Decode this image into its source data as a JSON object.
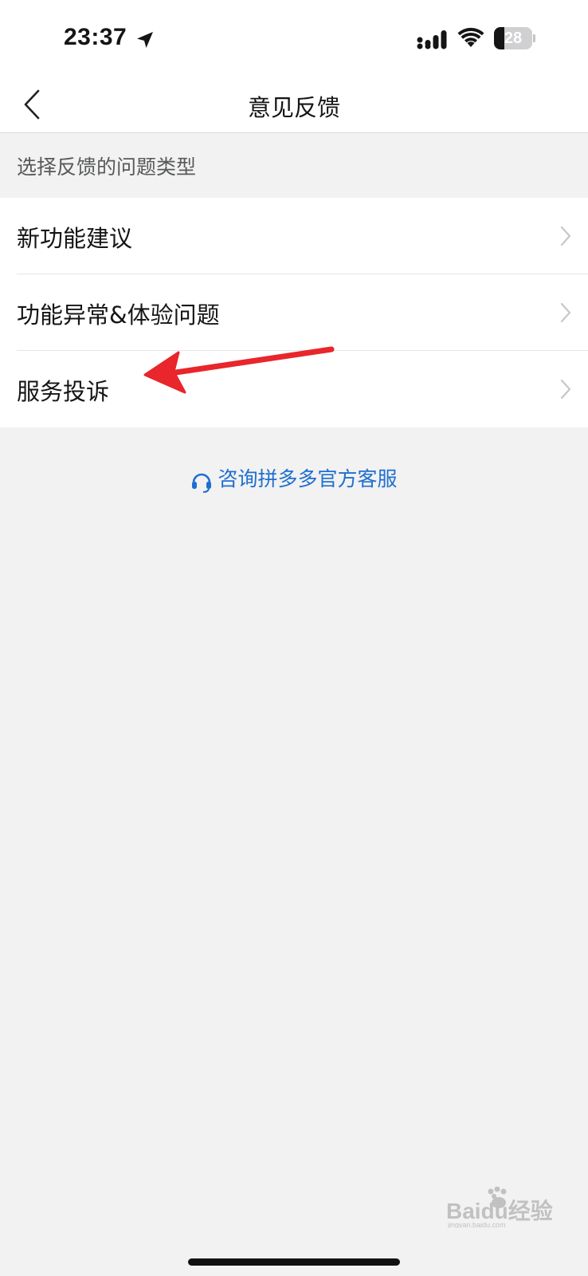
{
  "status_bar": {
    "time": "23:37",
    "battery_level": "28",
    "battery_fraction": 0.28
  },
  "nav": {
    "title": "意见反馈",
    "back_icon": "chevron-left-icon"
  },
  "section": {
    "header": "选择反馈的问题类型"
  },
  "feedback_types": [
    {
      "label": "新功能建议"
    },
    {
      "label": "功能异常&体验问题"
    },
    {
      "label": "服务投诉"
    }
  ],
  "customer_service": {
    "label": "咨询拼多多官方客服",
    "icon": "headset-icon",
    "color": "#1f6fd0"
  },
  "annotation": {
    "type": "arrow",
    "color": "#e8262b",
    "points_to": "服务投诉"
  },
  "watermark": {
    "text": "Baidu经验",
    "subtext": "jingyan.baidu.com"
  },
  "colors": {
    "background": "#f2f2f2",
    "surface": "#ffffff",
    "text_primary": "#151516",
    "text_secondary": "#58595b",
    "link": "#1f6fd0"
  }
}
